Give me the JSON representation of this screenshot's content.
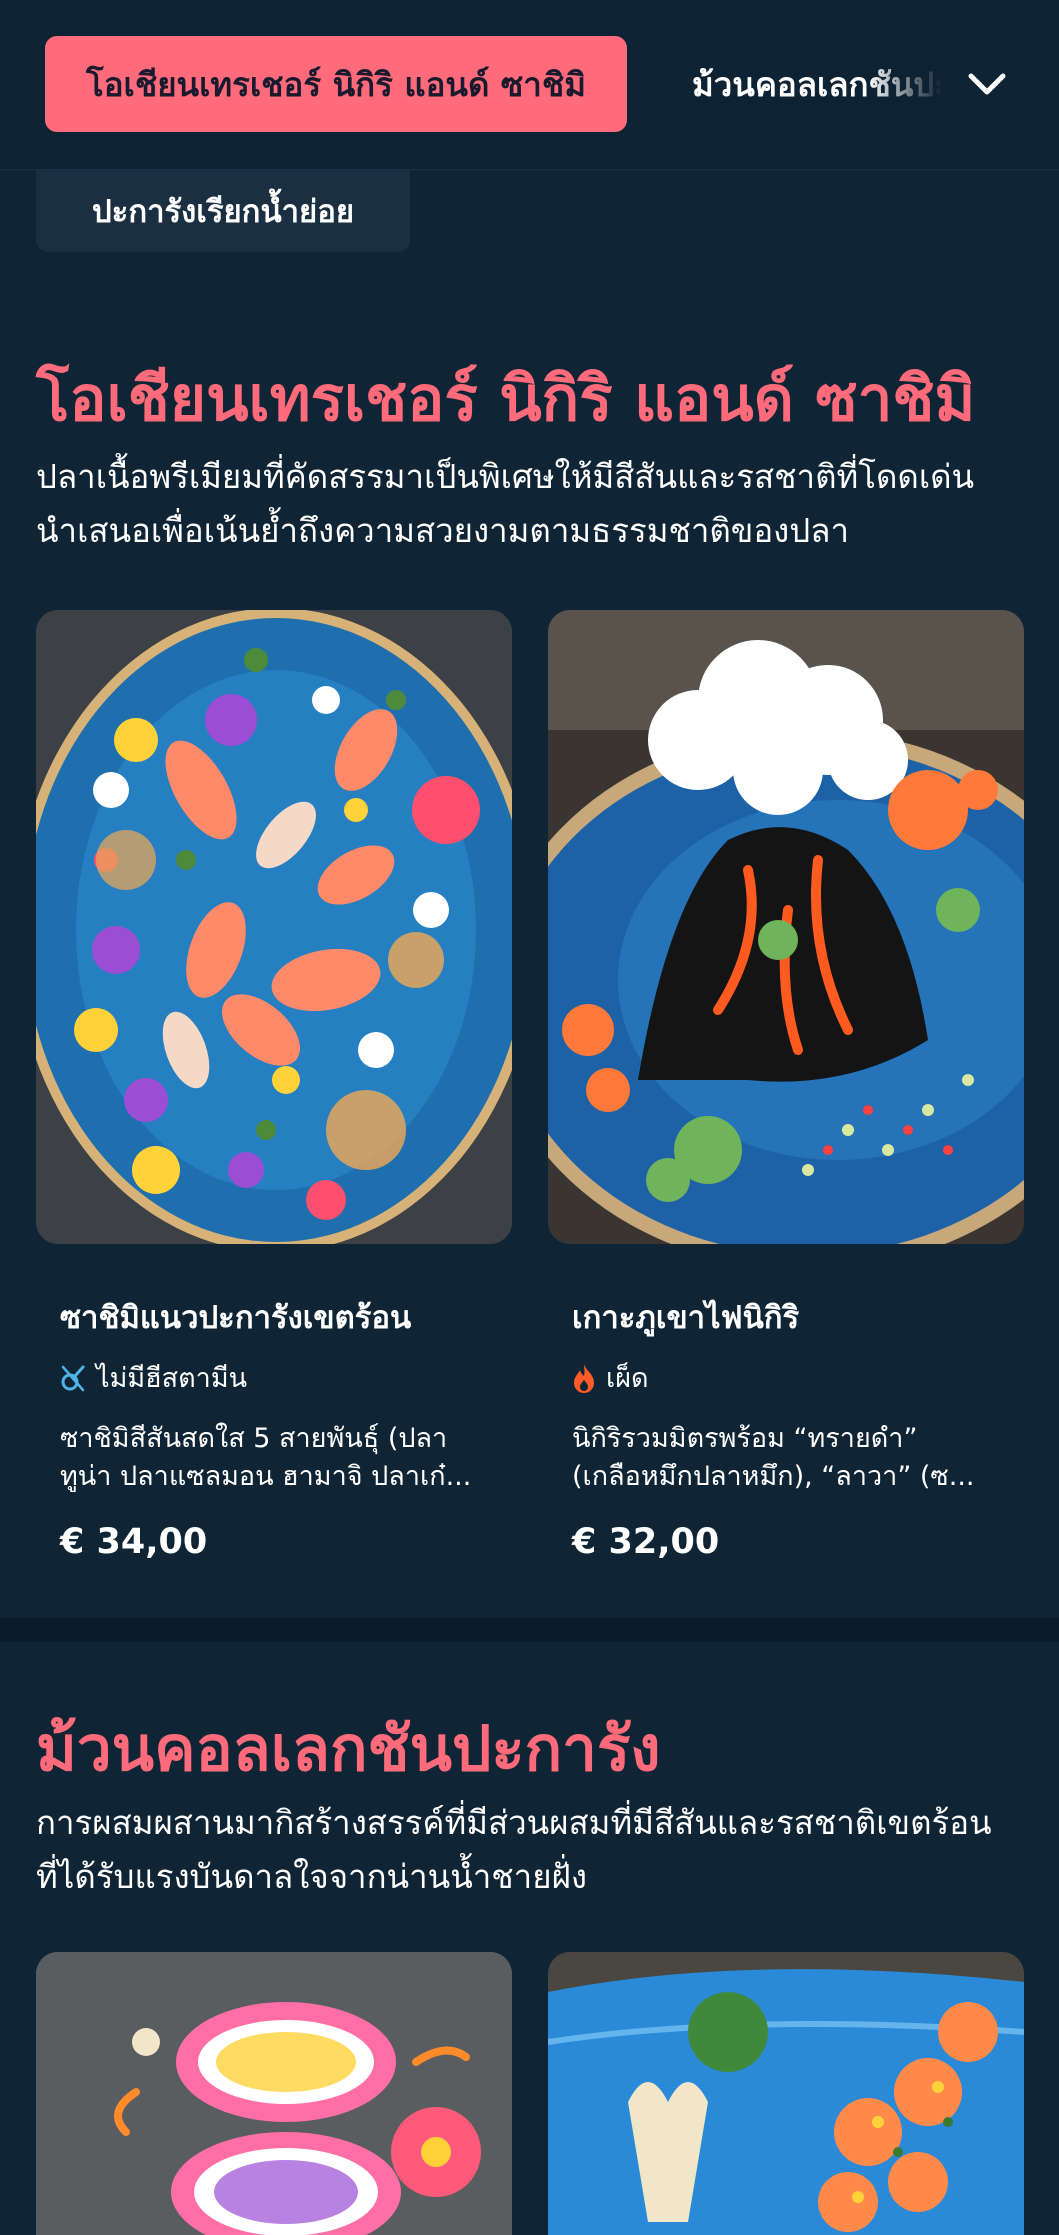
{
  "nav": {
    "active_category": "โอเชียนเทรเชอร์ นิกิริ แอนด์ ซาชิมิ",
    "next_category": "ม้วนคอลเลกชันปะการัง",
    "sub_category": "ปะการังเรียกน้ำย่อย"
  },
  "sections": [
    {
      "title": "โอเชียนเทรเชอร์ นิกิริ แอนด์ ซาชิมิ",
      "description_lines": [
        "ปลาเนื้อพรีเมียมที่คัดสรรมาเป็นพิเศษให้มีสีสันและรสชาติที่โดดเด่น",
        "นำเสนอเพื่อเน้นย้ำถึงความสวยงามตามธรรมชาติของปลา"
      ],
      "items": [
        {
          "name": "ซาชิมิแนวปะการังเขตร้อน",
          "tag": "ไม่มีฮีสตามีน",
          "tag_icon": "histamine-free-icon",
          "desc_lines": [
            "ซาชิมิสีสันสดใส 5 สายพันธุ์ (ปลา",
            "ทูน่า ปลาแซลมอน ฮามาจิ ปลาเก๋..."
          ],
          "price": "€ 34,00",
          "image": "sashimi-flower-plate"
        },
        {
          "name": "เกาะภูเขาไฟนิกิริ",
          "tag": "เผ็ด",
          "tag_icon": "flame-icon",
          "desc_lines": [
            "นิกิริรวมมิตรพร้อม “ทรายดำ”",
            "(เกลือหมึกปลาหมึก), “ลาวา” (ซ..."
          ],
          "price": "€ 32,00",
          "image": "volcano-nigiri-plate"
        }
      ]
    },
    {
      "title": "ม้วนคอลเลกชันปะการัง",
      "description_lines": [
        "การผสมผสานมากิสร้างสรรค์ที่มีส่วนผสมที่มีสีสันและรสชาติเขตร้อน",
        "ที่ได้รับแรงบันดาลใจจากน่านน้ำชายฝั่ง"
      ]
    }
  ],
  "colors": {
    "accent": "#ff6b7a",
    "background": "#0f2535",
    "spicy": "#ff5a2a",
    "histamine": "#4fb3e8"
  }
}
